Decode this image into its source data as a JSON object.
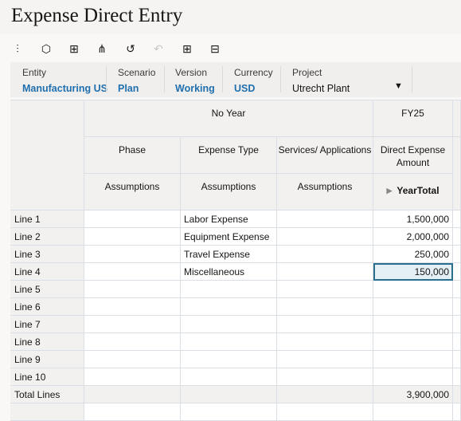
{
  "title": "Expense Direct Entry",
  "toolbar": [
    "sliders-icon",
    "cube-icon",
    "comment-add-icon",
    "hierarchy-icon",
    "history-icon",
    "undo-icon",
    "grid-icon",
    "pane-icon"
  ],
  "pov": [
    {
      "label": "Entity",
      "value": "Manufacturing US"
    },
    {
      "label": "Scenario",
      "value": "Plan"
    },
    {
      "label": "Version",
      "value": "Working"
    },
    {
      "label": "Currency",
      "value": "USD"
    },
    {
      "label": "Project",
      "value": "Utrecht Plant"
    }
  ],
  "grid": {
    "year_headers": [
      "No Year",
      "FY25"
    ],
    "col_headers": [
      "Phase",
      "Expense Type",
      "Services/ Applications",
      "Direct Expense Amount"
    ],
    "sub_headers": [
      "Assumptions",
      "Assumptions",
      "Assumptions",
      "YearTotal"
    ],
    "rows": [
      {
        "label": "Line 1",
        "phase": "",
        "type": "Labor Expense",
        "svc": "",
        "amount": "1,500,000"
      },
      {
        "label": "Line 2",
        "phase": "",
        "type": "Equipment Expense",
        "svc": "",
        "amount": "2,000,000"
      },
      {
        "label": "Line 3",
        "phase": "",
        "type": "Travel Expense",
        "svc": "",
        "amount": "250,000"
      },
      {
        "label": "Line 4",
        "phase": "",
        "type": "Miscellaneous",
        "svc": "",
        "amount": "150,000"
      },
      {
        "label": "Line 5",
        "phase": "",
        "type": "",
        "svc": "",
        "amount": ""
      },
      {
        "label": "Line 6",
        "phase": "",
        "type": "",
        "svc": "",
        "amount": ""
      },
      {
        "label": "Line 7",
        "phase": "",
        "type": "",
        "svc": "",
        "amount": ""
      },
      {
        "label": "Line 8",
        "phase": "",
        "type": "",
        "svc": "",
        "amount": ""
      },
      {
        "label": "Line 9",
        "phase": "",
        "type": "",
        "svc": "",
        "amount": ""
      },
      {
        "label": "Line 10",
        "phase": "",
        "type": "",
        "svc": "",
        "amount": ""
      },
      {
        "label": "Total Lines",
        "phase": "",
        "type": "",
        "svc": "",
        "amount": "3,900,000"
      }
    ],
    "selected_row": "Line 4"
  }
}
